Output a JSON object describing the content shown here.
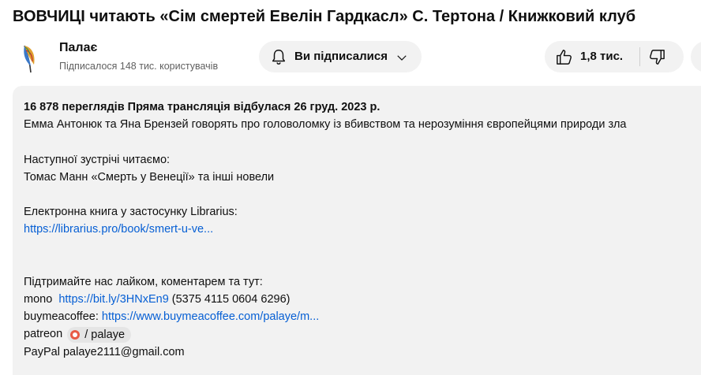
{
  "video": {
    "title": "ВОВЧИЦІ читають «Сім смертей Евелін Гардкасл» С. Тертона / Книжковий клуб"
  },
  "channel": {
    "name": "Палає",
    "subscribers": "Підписалося 148 тис. користувачів",
    "avatar_icon": "feather-logo-icon"
  },
  "actions": {
    "subscribe_label": "Ви підписалися",
    "like_count": "1,8 тис."
  },
  "description": {
    "meta": "16 878 переглядів  Пряма трансляція відбулася 26 груд. 2023 р.",
    "line1": "Емма Антонюк та Яна Брензей говорять про  головоломку із вбивством та нерозуміння європейцями природи зла",
    "next_heading": "Наступної зустрічі читаємо:",
    "next_book": "Томас Манн «Смерть у Венеції» та інші новели",
    "ebook_label": "Електронна книга у застосунку Librarius:",
    "ebook_link": "https://librarius.pro/book/smert-u-ve...",
    "support_heading": "Підтримайте нас лайком, коментарем та тут:",
    "mono_label": "mono",
    "mono_link": "https://bit.ly/3HNxEn9",
    "mono_card": " (5375 4115 0604 6296)",
    "bmac_label": "buymeacoffee: ",
    "bmac_link": "https://www.buymeacoffee.com/palaye/m...",
    "patreon_label": "patreon",
    "patreon_tag": "/ palaye",
    "paypal": "PayPal palaye2111@gmail.com"
  },
  "colors": {
    "link": "#065fd4",
    "button_bg": "#f2f2f2",
    "patreon": "#e85b46"
  }
}
